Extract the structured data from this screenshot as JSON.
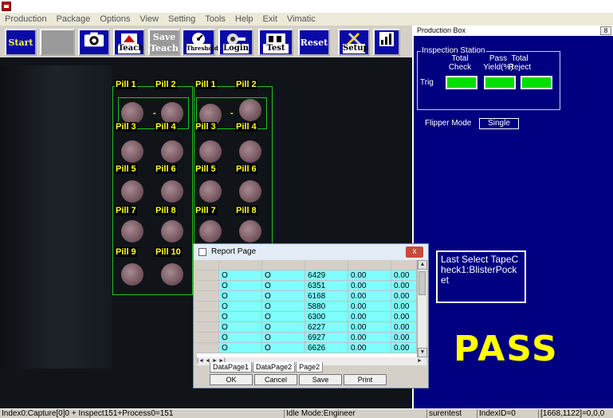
{
  "menu": [
    "Production",
    "Package",
    "Options",
    "View",
    "Setting",
    "Tools",
    "Help",
    "Exit",
    "Vimatic"
  ],
  "toolbar": {
    "start": "Start",
    "teach": "Teach",
    "save_teach_top": "Save",
    "save_teach_bottom": "Teach",
    "threshold": "Threshold",
    "login": "Login",
    "test": "Test",
    "reset": "Reset",
    "setup": "Setup"
  },
  "camera": {
    "pill_labels": {
      "l1": "Pill 1",
      "l2": "Pill 2",
      "r1": "Pill 1",
      "r2": "Pill 2",
      "l3": "Pill 3",
      "l4": "Pill 4",
      "r3": "Pill 3",
      "r4": "Pill 4",
      "l5": "Pill 5",
      "l6": "Pill 6",
      "r5": "Pill 5",
      "r6": "Pill 6",
      "l7": "Pill 7",
      "l8": "Pill 8",
      "r7": "Pill 7",
      "r8": "Pill 8",
      "l9": "Pill 9",
      "l10": "Pill 10"
    },
    "dash": "-"
  },
  "production_box": {
    "title": "Production Box",
    "title_btn": "8",
    "station_legend": "Inspection Station",
    "col_total_check": "Total Check",
    "col_pass_yield": "Pass Yield(%)",
    "col_total_reject": "Total Reject",
    "row_label": "Trig",
    "flipper_mode_label": "Flipper Mode",
    "flipper_mode_value": "Single",
    "last_select": "Last Select TapeCheck1:BlisterPocket",
    "result": "PASS",
    "indicator_color": "#00e000",
    "result_color": "#ffff00"
  },
  "report": {
    "title": "Report Page",
    "close": "x",
    "rows": [
      [
        "O",
        "O",
        "6429",
        "0.00",
        "0.00"
      ],
      [
        "O",
        "O",
        "6351",
        "0.00",
        "0.00"
      ],
      [
        "O",
        "O",
        "6168",
        "0.00",
        "0.00"
      ],
      [
        "O",
        "O",
        "5880",
        "0.00",
        "0.00"
      ],
      [
        "O",
        "O",
        "6300",
        "0.00",
        "0.00"
      ],
      [
        "O",
        "O",
        "6227",
        "0.00",
        "0.00"
      ],
      [
        "O",
        "O",
        "6927",
        "0.00",
        "0.00"
      ],
      [
        "O",
        "O",
        "6626",
        "0.00",
        "0.00"
      ]
    ],
    "nav": [
      "|◄",
      "◄",
      "►",
      "►|"
    ],
    "tabs": [
      "DataPage1",
      "DataPage2",
      "Page2"
    ],
    "buttons": [
      "OK",
      "Cancel",
      "Save",
      "Print"
    ]
  },
  "status": {
    "capture": "Index0:Capture[0]0 + Inspect151+Process0=151",
    "mode": "Idle Mode:Engineer",
    "user": "surentest",
    "index_id": "IndexID=0",
    "coords": "[1668,1122]=0,0,0"
  }
}
